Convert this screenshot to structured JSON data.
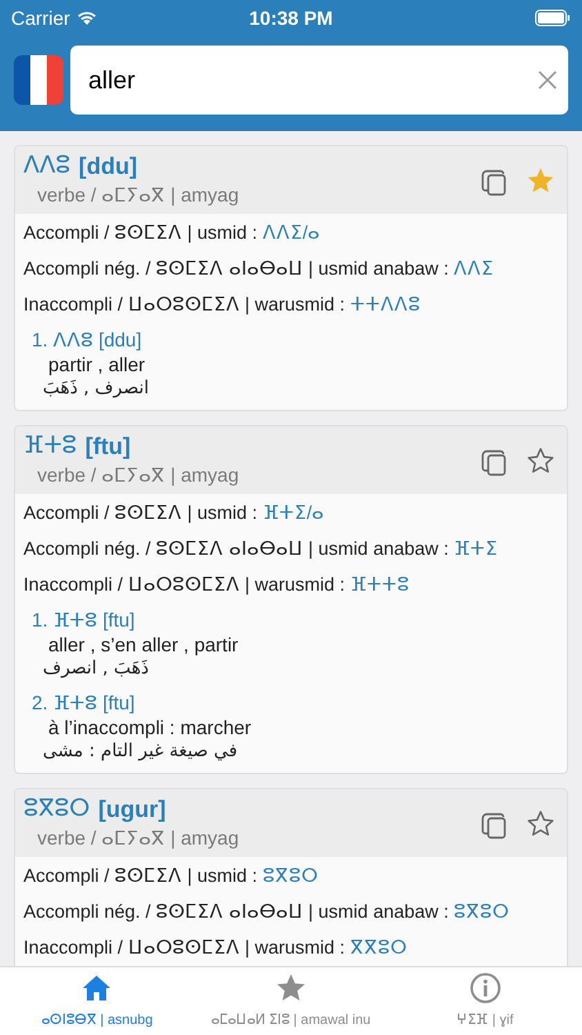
{
  "status_bar": {
    "carrier": "Carrier",
    "time": "10:38 PM"
  },
  "search": {
    "value": "aller"
  },
  "entries": [
    {
      "headword": "ⴷⴷⵓ",
      "latin": "[ddu]",
      "pos": "verbe / ⴰⵎⵢⴰⴳ | amyag",
      "starred": true,
      "forms": [
        {
          "label": "Accompli / ⵓⵙⵎⵉⴷ | usmid :",
          "value": "ⴷⴷⵉ/ⴰ"
        },
        {
          "label": "Accompli nég. / ⵓⵙⵎⵉⴷ ⴰⵏⴰⴱⴰⵡ | usmid anabaw :",
          "value": "ⴷⴷⵉ"
        },
        {
          "label": "Inaccompli / ⵡⴰⵔⵓⵙⵎⵉⴷ | warusmid :",
          "value": "ⵜⵜⴷⴷⵓ"
        }
      ],
      "senses": [
        {
          "heading": "1. ⴷⴷⵓ [ddu]",
          "french": "partir , aller",
          "arabic": "انصرف , ذَهَبَ"
        }
      ]
    },
    {
      "headword": "ⴼⵜⵓ",
      "latin": "[ftu]",
      "pos": "verbe / ⴰⵎⵢⴰⴳ | amyag",
      "starred": false,
      "forms": [
        {
          "label": "Accompli / ⵓⵙⵎⵉⴷ | usmid :",
          "value": "ⴼⵜⵉ/ⴰ"
        },
        {
          "label": "Accompli nég. / ⵓⵙⵎⵉⴷ ⴰⵏⴰⴱⴰⵡ | usmid anabaw :",
          "value": "ⴼⵜⵉ"
        },
        {
          "label": "Inaccompli / ⵡⴰⵔⵓⵙⵎⵉⴷ | warusmid :",
          "value": "ⴼⵜⵜⵓ"
        }
      ],
      "senses": [
        {
          "heading": "1. ⴼⵜⵓ [ftu]",
          "french": "aller , s’en aller , partir",
          "arabic": "ذَهَبَ , انصرف"
        },
        {
          "heading": "2. ⴼⵜⵓ [ftu]",
          "french": "à l’inaccompli : marcher",
          "arabic": "في صيغة غير التام : مشى"
        }
      ]
    },
    {
      "headword": "ⵓⴳⵓⵔ",
      "latin": "[ugur]",
      "pos": "verbe / ⴰⵎⵢⴰⴳ | amyag",
      "starred": false,
      "forms": [
        {
          "label": "Accompli / ⵓⵙⵎⵉⴷ | usmid :",
          "value": "ⵓⴳⵓⵔ"
        },
        {
          "label": "Accompli nég. / ⵓⵙⵎⵉⴷ ⴰⵏⴰⴱⴰⵡ | usmid anabaw :",
          "value": "ⵓⴳⵓⵔ"
        },
        {
          "label": "Inaccompli / ⵡⴰⵔⵓⵙⵎⵉⴷ | warusmid :",
          "value": "ⴳⴳⵓⵔ"
        }
      ]
    }
  ],
  "tabs": [
    {
      "kind": "home",
      "label": "ⴰⵙⵏⵓⴱⴳ | asnubg",
      "selected": true
    },
    {
      "kind": "star",
      "label": "ⴰⵎⴰⵡⴰⵍ ⵉⵏⵓ | amawal inu",
      "selected": false
    },
    {
      "kind": "info",
      "label": "ⵖⵉⴼ | ɣif",
      "selected": false
    }
  ]
}
